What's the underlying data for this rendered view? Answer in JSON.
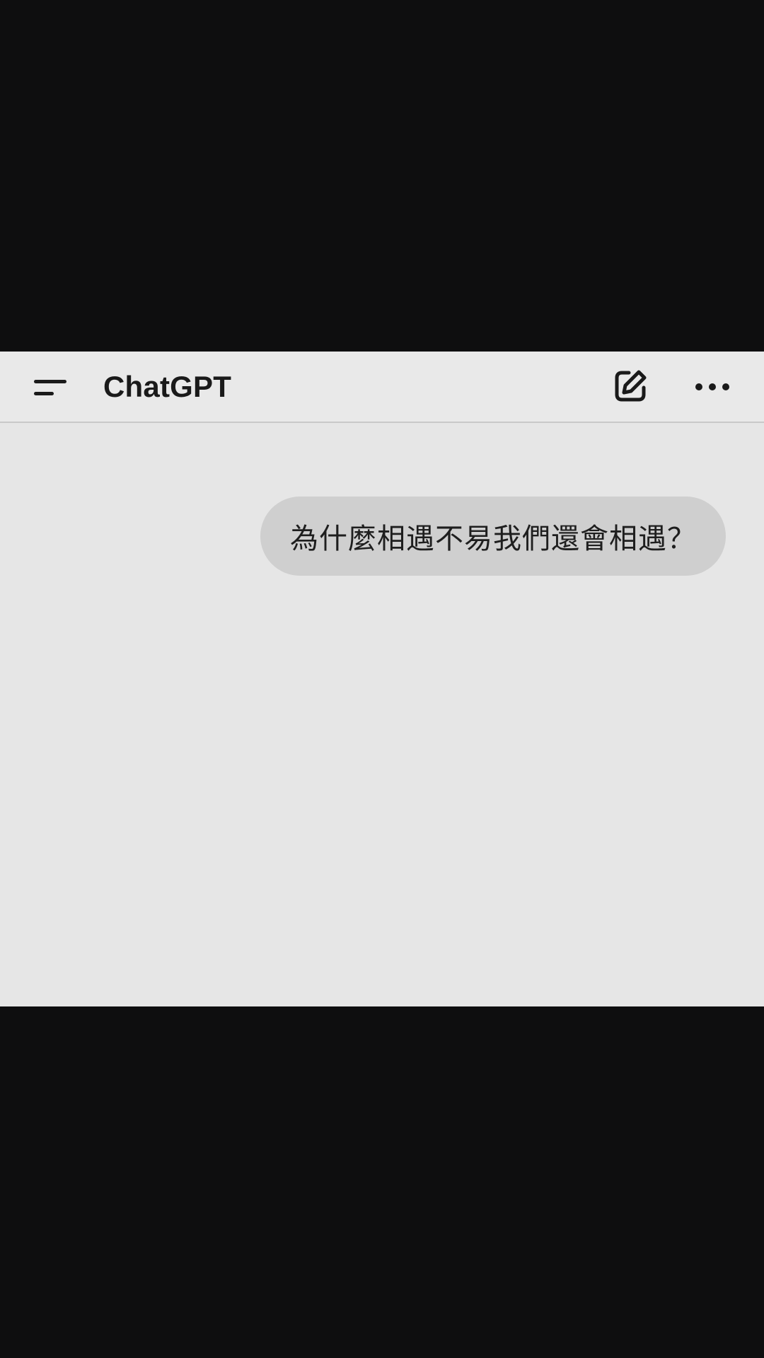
{
  "app": {
    "title": "ChatGPT"
  },
  "header": {
    "menu_icon": "menu-icon",
    "new_chat_icon": "edit-icon",
    "more_icon": "ellipsis-icon"
  },
  "messages": [
    {
      "role": "user",
      "text": "為什麼相遇不易我們還會相遇？"
    }
  ],
  "colors": {
    "background": "#e6e6e6",
    "header_background": "#e9e9e9",
    "user_bubble": "#cfcfcf",
    "letterbox": "#0e0e0f",
    "text": "#1a1a1a"
  }
}
